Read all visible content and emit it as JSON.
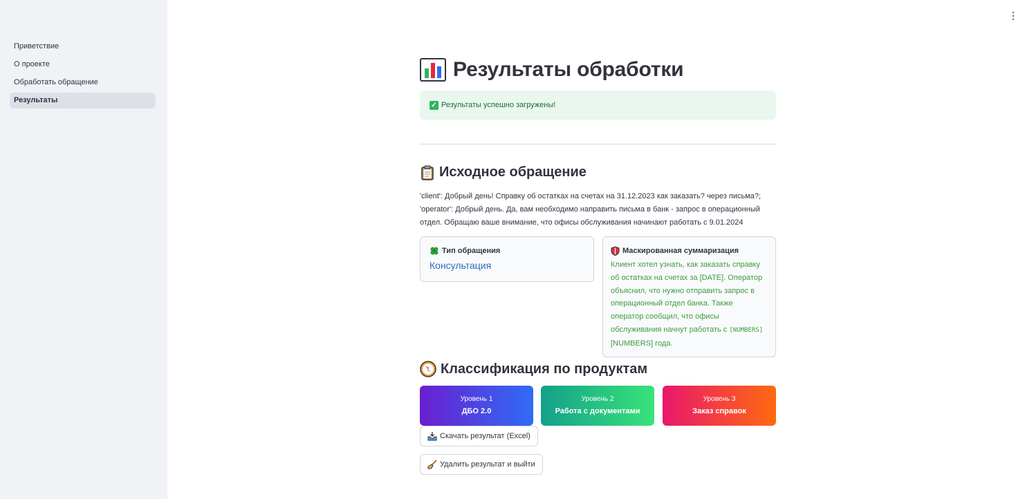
{
  "sidebar": {
    "items": [
      {
        "label": "Приветствие"
      },
      {
        "label": "О проекте"
      },
      {
        "label": "Обработать обращение"
      },
      {
        "label": "Результаты",
        "active": true
      }
    ]
  },
  "page": {
    "title": "Результаты обработки",
    "title_icon": "bar-chart-icon"
  },
  "alert": {
    "text": "Результаты успешно загружены!",
    "icon": "check-mark-icon"
  },
  "source": {
    "heading": "Исходное обращение",
    "heading_icon": "clipboard-icon",
    "line1": "'client': Добрый день! Справку об остатках на счетах на 31.12.2023 как заказать? через письма?;",
    "line2": "'operator': Добрый день. Да, вам необходимо направить письма в банк - запрос в операционный",
    "line3": "отдел. Обращаю ваше внимание, что офисы обслуживания начинают работать с 9.01.2024"
  },
  "type_card": {
    "label": "Тип обращения",
    "icon": "clover-icon",
    "value": "Консультация"
  },
  "summary_card": {
    "label": "Маскированная суммаризация",
    "icon": "shield-icon",
    "l1": "Клиент хотел узнать, как заказать справку",
    "l2": "об остатках на счетах за [DATE]. Оператор",
    "l3": "объяснил, что нужно отправить запрос в",
    "l4": "операционный отдел банка. Также",
    "l5": "оператор сообщил, что офисы",
    "l6a": "обслуживания начнут работать с ",
    "l6b": "[NUMBERS]",
    "l7": "[NUMBERS] года."
  },
  "classification": {
    "heading": "Классификация по продуктам",
    "heading_icon": "compass-icon",
    "levels": [
      {
        "name": "Уровень 1",
        "value": "ДБО 2.0",
        "colors": [
          "#6a1fd0",
          "#2f6cf5"
        ]
      },
      {
        "name": "Уровень 2",
        "value": "Работа с документами",
        "colors": [
          "#14a08a",
          "#39e37a"
        ]
      },
      {
        "name": "Уровень 3",
        "value": "Заказ справок",
        "colors": [
          "#e8186c",
          "#ff6a10"
        ]
      }
    ]
  },
  "buttons": {
    "download": "Скачать результат (Excel)",
    "download_icon": "inbox-tray-icon",
    "delete": "Удалить результат и выйти",
    "delete_icon": "broom-icon"
  },
  "colors": {
    "sidebar_bg": "#f0f2f6",
    "accent_blue": "#2f6cbf",
    "success_bg": "#e9f7ee",
    "summary_green": "#3d9b3d"
  }
}
